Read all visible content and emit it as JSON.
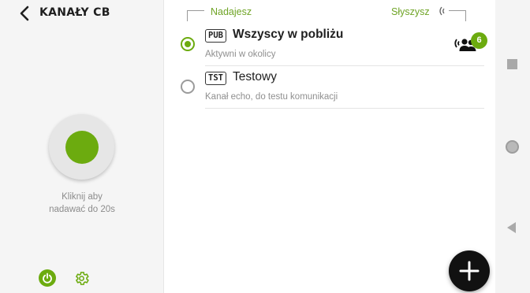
{
  "app": {
    "title": "KANAŁY CB"
  },
  "ptt": {
    "hint_line1": "Kliknij aby",
    "hint_line2": "nadawać do 20s"
  },
  "columns": {
    "transmit": "Nadajesz",
    "listen": "Słyszysz"
  },
  "channels": [
    {
      "tag": "PUB",
      "name": "Wszyscy w pobliżu",
      "description": "Aktywni w okolicy",
      "selected": true,
      "listeners": "6"
    },
    {
      "tag": "TST",
      "name": "Testowy",
      "description": "Kanał echo, do testu komunikacji",
      "selected": false
    }
  ],
  "icons": {
    "back": "arrow-back-icon",
    "power": "power-icon",
    "settings": "gear-icon",
    "listeners": "group-speaker-icon",
    "add": "plus-icon",
    "signal": "signal-wave-icon"
  },
  "colors": {
    "accent": "#6cab0f",
    "header_text": "#6fa426",
    "fab": "#111111"
  }
}
